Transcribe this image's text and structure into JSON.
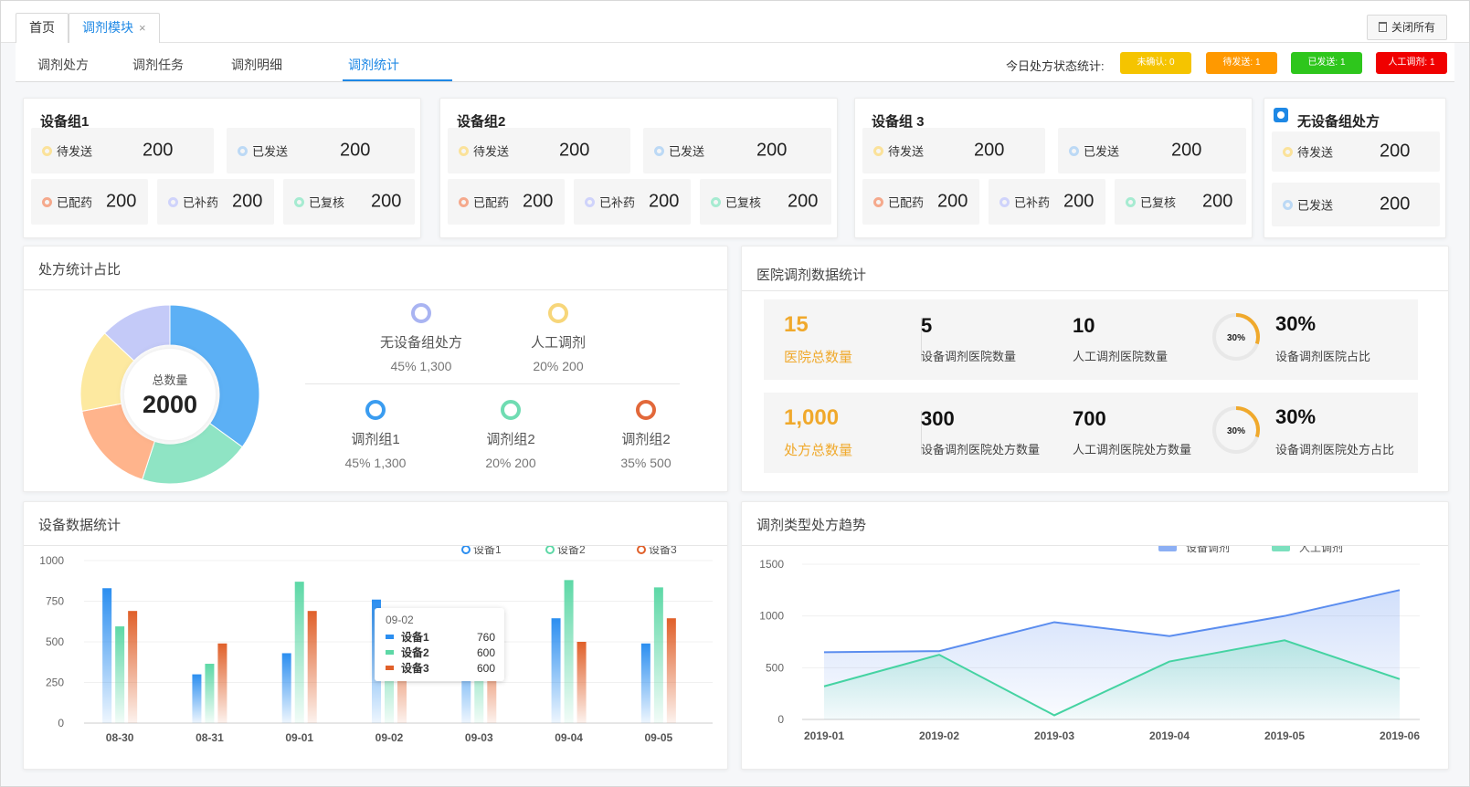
{
  "tabs": {
    "home": "首页",
    "module": "调剂模块",
    "close_x": "×",
    "close_all": "关闭所有"
  },
  "subnav": {
    "items": [
      "调剂处方",
      "调剂任务",
      "调剂明细",
      "调剂统计"
    ],
    "status_label": "今日处方状态统计:",
    "pills": [
      {
        "label": "未确认: 0",
        "color": "#f5c400"
      },
      {
        "label": "待发送: 1",
        "color": "#ff9900"
      },
      {
        "label": "已发送: 1",
        "color": "#2ec61c"
      },
      {
        "label": "人工调剂: 1",
        "color": "#f00000"
      }
    ]
  },
  "groups": [
    {
      "title": "设备组1",
      "pending_label": "待发送",
      "pending": "200",
      "sent_label": "已发送",
      "sent": "200",
      "dispensed_label": "已配药",
      "dispensed": "200",
      "refill_label": "已补药",
      "refill": "200",
      "checked_label": "已复核",
      "checked": "200"
    },
    {
      "title": "设备组2",
      "pending_label": "待发送",
      "pending": "200",
      "sent_label": "已发送",
      "sent": "200",
      "dispensed_label": "已配药",
      "dispensed": "200",
      "refill_label": "已补药",
      "refill": "200",
      "checked_label": "已复核",
      "checked": "200"
    },
    {
      "title": "设备组 3",
      "pending_label": "待发送",
      "pending": "200",
      "sent_label": "已发送",
      "sent": "200",
      "dispensed_label": "已配药",
      "dispensed": "200",
      "refill_label": "已补药",
      "refill": "200",
      "checked_label": "已复核",
      "checked": "200"
    }
  ],
  "nogroup": {
    "title": "无设备组处方",
    "pending_label": "待发送",
    "pending": "200",
    "sent_label": "已发送",
    "sent": "200"
  },
  "ratio_panel": {
    "title": "处方统计占比",
    "center_label": "总数量",
    "center_value": "2000",
    "legend": [
      {
        "name": "无设备组处方",
        "value": "45% 1,300",
        "color": "#a9b4f2"
      },
      {
        "name": "人工调剂",
        "value": "20% 200",
        "color": "#f7d67a"
      },
      {
        "name": "调剂组1",
        "value": "45% 1,300",
        "color": "#3a9cf0"
      },
      {
        "name": "调剂组2",
        "value": "20% 200",
        "color": "#6fdcb2"
      },
      {
        "name": "调剂组2",
        "value": "35% 500",
        "color": "#e2683a"
      }
    ]
  },
  "hospital_panel": {
    "title": "医院调剂数据统计",
    "row1": {
      "big": "15",
      "big_label": "医院总数量",
      "a": "5",
      "a_label": "设备调剂医院数量",
      "b": "10",
      "b_label": "人工调剂医院数量",
      "gauge_text": "30%",
      "gauge_fraction": 0.3,
      "pct": "30%",
      "pct_label": "设备调剂医院占比"
    },
    "row2": {
      "big": "1,000",
      "big_label": "处方总数量",
      "a": "300",
      "a_label": "设备调剂医院处方数量",
      "b": "700",
      "b_label": "人工调剂医院处方数量",
      "gauge_text": "30%",
      "gauge_fraction": 0.3,
      "pct": "30%",
      "pct_label": "设备调剂医院处方占比"
    },
    "accent": "#f0a92c"
  },
  "device_panel": {
    "title": "设备数据统计"
  },
  "trend_panel": {
    "title": "调剂类型处方趋势"
  },
  "tooltip": {
    "title": "09-02",
    "rows": [
      {
        "name": "设备1",
        "value": "760"
      },
      {
        "name": "设备2",
        "value": "600"
      },
      {
        "name": "设备3",
        "value": "600"
      }
    ]
  },
  "chart_data": [
    {
      "type": "pie",
      "title": "",
      "labels": [
        "调剂组1",
        "调剂组2",
        "调剂组2",
        "人工调剂",
        "无设备组处方"
      ],
      "values": [
        35,
        20,
        17,
        15,
        13
      ],
      "colors": [
        "#5cb0f5",
        "#8fe4c4",
        "#ffb48c",
        "#fde9a0",
        "#c4caf8"
      ]
    },
    {
      "type": "bar",
      "categories": [
        "08-30",
        "08-31",
        "09-01",
        "09-02",
        "09-03",
        "09-04",
        "09-05"
      ],
      "series": [
        {
          "name": "设备1",
          "values": [
            830,
            300,
            430,
            760,
            540,
            645,
            490
          ],
          "color": "#2b8ef0"
        },
        {
          "name": "设备2",
          "values": [
            595,
            365,
            870,
            600,
            590,
            880,
            835
          ],
          "color": "#5dd8a6"
        },
        {
          "name": "设备3",
          "values": [
            690,
            490,
            690,
            600,
            560,
            500,
            645
          ],
          "color": "#e0602a"
        }
      ],
      "yticks": [
        0,
        250,
        500,
        750,
        1000
      ],
      "ylim": [
        0,
        1000
      ],
      "legend": "top-right"
    },
    {
      "type": "area",
      "categories": [
        "2019-01",
        "2019-02",
        "2019-03",
        "2019-04",
        "2019-05",
        "2019-06"
      ],
      "series": [
        {
          "name": "设备调剂",
          "values": [
            650,
            660,
            940,
            805,
            1000,
            1250
          ],
          "color": "#5b8def"
        },
        {
          "name": "人工调剂",
          "values": [
            320,
            625,
            40,
            560,
            765,
            390
          ],
          "color": "#45d3a2"
        }
      ],
      "yticks": [
        0,
        500,
        1000,
        1500
      ],
      "ylim": [
        0,
        1500
      ],
      "legend": "top-right"
    }
  ]
}
